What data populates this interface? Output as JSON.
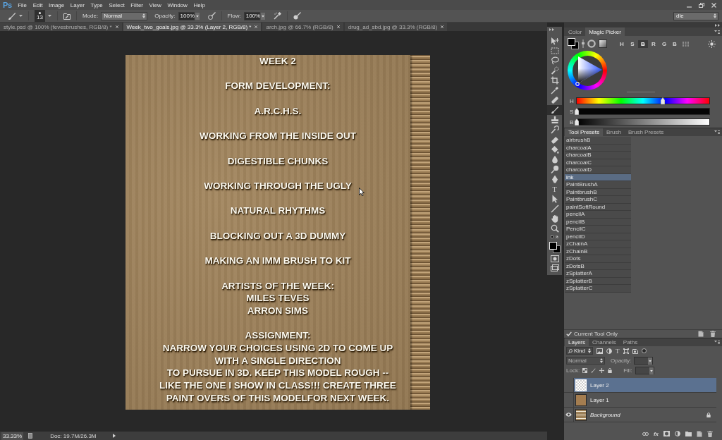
{
  "menu_bar": {
    "logo": "Ps",
    "items": [
      "File",
      "Edit",
      "Image",
      "Layer",
      "Type",
      "Select",
      "Filter",
      "View",
      "Window",
      "Help"
    ]
  },
  "options_bar": {
    "brush_size": "13",
    "mode_label": "Mode:",
    "mode": "Normal",
    "opacity_label": "Opacity:",
    "opacity": "100%",
    "flow_label": "Flow:",
    "flow": "100%",
    "workspace": "dle"
  },
  "document_tabs": [
    {
      "title": "style.psd @ 100% (fevesbrushes, RGB/8) *",
      "selected": false
    },
    {
      "title": "Week_two_goals.jpg @ 33.3% (Layer 2, RGB/8) *",
      "selected": true
    },
    {
      "title": "arch.jpg @ 66.7% (RGB/8)",
      "selected": false
    },
    {
      "title": "drug_ad_sbd.jpg @ 33.3% (RGB/8)",
      "selected": false
    }
  ],
  "document": {
    "blocks": [
      {
        "lines": [
          "WEEK 2"
        ]
      },
      {
        "lines": [
          "FORM DEVELOPMENT:"
        ]
      },
      {
        "lines": [
          "A.R.C.H.S."
        ]
      },
      {
        "lines": [
          "WORKING FROM THE INSIDE OUT"
        ]
      },
      {
        "lines": [
          "DIGESTIBLE CHUNKS"
        ]
      },
      {
        "lines": [
          "WORKING THROUGH THE UGLY"
        ]
      },
      {
        "lines": [
          "NATURAL RHYTHMS"
        ]
      },
      {
        "lines": [
          "BLOCKING OUT A 3D DUMMY"
        ]
      },
      {
        "lines": [
          "MAKING AN IMM BRUSH TO KIT"
        ]
      },
      {
        "lines": [
          "ARTISTS OF THE WEEK:",
          "MILES TEVES",
          "ARRON SIMS"
        ]
      },
      {
        "lines": [
          "ASSIGNMENT:",
          "NARROW YOUR CHOICES USING 2D TO COME UP",
          "WITH A SINGLE DIRECTION",
          "TO PURSUE IN 3D.  KEEP THIS MODEL ROUGH --",
          "LIKE THE ONE I SHOW IN CLASS!!! CREATE THREE",
          "PAINT OVERS OF THIS MODELFOR NEXT WEEK."
        ]
      }
    ]
  },
  "status_bar": {
    "zoom": "33.33%",
    "doc_size": "Doc: 19.7M/26.3M"
  },
  "tools": [
    {
      "kind": "move",
      "selected": false
    },
    {
      "kind": "marquee",
      "selected": false
    },
    {
      "kind": "lasso",
      "selected": false
    },
    {
      "kind": "quick_select",
      "selected": false
    },
    {
      "kind": "crop",
      "selected": false
    },
    {
      "kind": "eyedropper",
      "selected": false
    },
    {
      "kind": "heal",
      "selected": false
    },
    {
      "kind": "brush",
      "selected": true
    },
    {
      "kind": "stamp",
      "selected": false
    },
    {
      "kind": "history",
      "selected": false
    },
    {
      "kind": "eraser",
      "selected": false
    },
    {
      "kind": "bucket",
      "selected": false
    },
    {
      "kind": "blur",
      "selected": false
    },
    {
      "kind": "dodge",
      "selected": false
    },
    {
      "kind": "pen",
      "selected": false
    },
    {
      "kind": "type",
      "selected": false,
      "glyph": "T"
    },
    {
      "kind": "path_select",
      "selected": false
    },
    {
      "kind": "line",
      "selected": false
    },
    {
      "kind": "hand",
      "selected": false
    },
    {
      "kind": "zoom",
      "selected": false
    }
  ],
  "color_panel": {
    "tabs": [
      {
        "label": "Color",
        "selected": false
      },
      {
        "label": "Magic Picker",
        "selected": true
      }
    ],
    "modes": [
      {
        "label": "H",
        "selected": false
      },
      {
        "label": "S",
        "selected": false
      },
      {
        "label": "B",
        "selected": true
      },
      {
        "label": "R",
        "selected": false
      },
      {
        "label": "G",
        "selected": false
      },
      {
        "label": "B",
        "selected": false
      }
    ],
    "sliders": [
      {
        "kind": "hue",
        "label": "H",
        "level": 0.65
      },
      {
        "kind": "saturation",
        "label": "S",
        "level": 0
      },
      {
        "kind": "brightness",
        "label": "B",
        "level": 0
      }
    ]
  },
  "tool_presets_panel": {
    "tabs": [
      {
        "label": "Tool Presets",
        "selected": true
      },
      {
        "label": "Brush",
        "selected": false
      },
      {
        "label": "Brush Presets",
        "selected": false
      }
    ],
    "presets": [
      {
        "name": "airbrushB",
        "selected": false
      },
      {
        "name": "charcoalA",
        "selected": false
      },
      {
        "name": "charcoalB",
        "selected": false
      },
      {
        "name": "charcoalC",
        "selected": false
      },
      {
        "name": "charcoalD",
        "selected": false
      },
      {
        "name": "ink",
        "selected": true
      },
      {
        "name": "PaintBrushA",
        "selected": false
      },
      {
        "name": "PaintbrushB",
        "selected": false
      },
      {
        "name": "PaintbrushC",
        "selected": false
      },
      {
        "name": "paintSoftRound",
        "selected": false
      },
      {
        "name": "pencilA",
        "selected": false
      },
      {
        "name": "pencilB",
        "selected": false
      },
      {
        "name": "PencilC",
        "selected": false
      },
      {
        "name": "pencilD",
        "selected": false
      },
      {
        "name": "zChainA",
        "selected": false
      },
      {
        "name": "zChainB",
        "selected": false
      },
      {
        "name": "zDots",
        "selected": false
      },
      {
        "name": "zDotsB",
        "selected": false
      },
      {
        "name": "zSplatterA",
        "selected": false
      },
      {
        "name": "zSplatterB",
        "selected": false
      },
      {
        "name": "zSplatterC",
        "selected": false
      }
    ],
    "current_tool_only": {
      "label": "Current Tool Only",
      "checked": true
    }
  },
  "layers_panel": {
    "tabs": [
      {
        "label": "Layers",
        "selected": true
      },
      {
        "label": "Channels",
        "selected": false
      },
      {
        "label": "Paths",
        "selected": false
      }
    ],
    "filter": "Kind",
    "type_filter": "T",
    "options_disabled": true,
    "blend_mode": "Normal",
    "opacity_label": "Opacity:",
    "lock_label": "Lock:",
    "fill_label": "Fill:",
    "layers": [
      {
        "kind": "transparent",
        "name": "Layer 2",
        "visible": false,
        "selected": true,
        "locked": false
      },
      {
        "kind": "fill",
        "name": "Layer 1",
        "visible": false,
        "selected": false,
        "locked": false
      },
      {
        "kind": "image",
        "name": "Background",
        "visible": true,
        "selected": false,
        "locked": true
      }
    ],
    "style_button": "fx"
  }
}
